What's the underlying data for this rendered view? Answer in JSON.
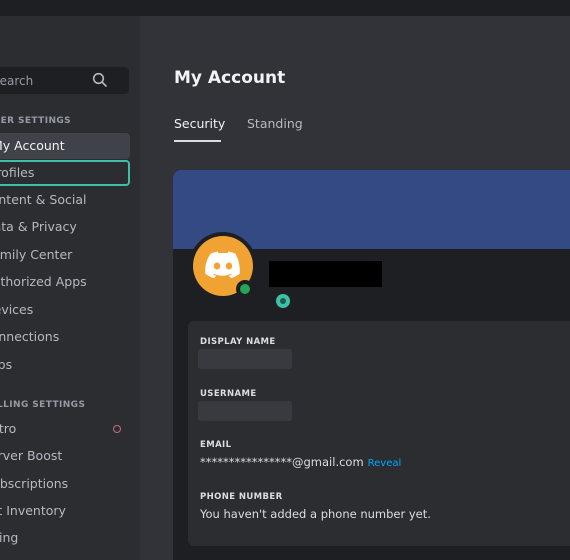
{
  "search": {
    "placeholder": "Search"
  },
  "sidebar": {
    "user_settings_header": "USER SETTINGS",
    "billing_settings_header": "BILLING SETTINGS",
    "items": [
      {
        "label": "My Account"
      },
      {
        "label": "Profiles"
      },
      {
        "label": "Content & Social"
      },
      {
        "label": "Data & Privacy"
      },
      {
        "label": "Family Center"
      },
      {
        "label": "Authorized Apps"
      },
      {
        "label": "Devices"
      },
      {
        "label": "Connections"
      },
      {
        "label": "Clips"
      }
    ],
    "billing_items": [
      {
        "label": "Nitro"
      },
      {
        "label": "Server Boost"
      },
      {
        "label": "Subscriptions"
      },
      {
        "label": "Gift Inventory"
      },
      {
        "label": "Billing"
      }
    ]
  },
  "main": {
    "title": "My Account",
    "tabs": [
      {
        "label": "Security"
      },
      {
        "label": "Standing"
      }
    ]
  },
  "account": {
    "display_name_label": "DISPLAY NAME",
    "username_label": "USERNAME",
    "email_label": "EMAIL",
    "email_value": "****************@gmail.com",
    "reveal_label": "Reveal",
    "phone_label": "PHONE NUMBER",
    "phone_value": "You haven't added a phone number yet."
  },
  "colors": {
    "banner": "#344a85",
    "avatar": "#f0a232",
    "online": "#23a55a",
    "accent_focus": "#3fbfa5",
    "link": "#00a8fc"
  }
}
